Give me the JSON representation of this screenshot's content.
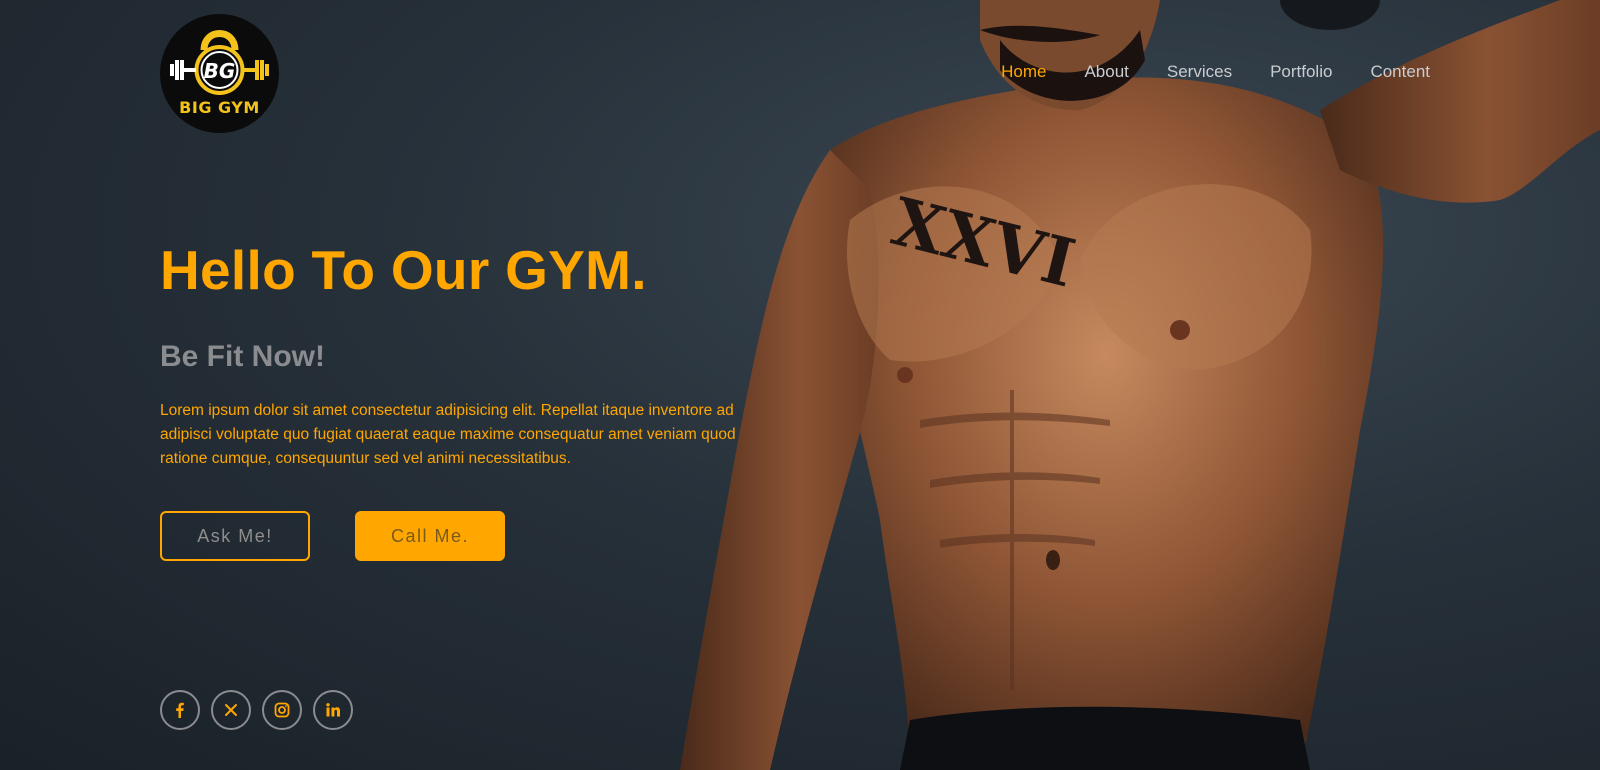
{
  "brand": {
    "logo_initials": "BG",
    "logo_text": "BIG GYM"
  },
  "nav": {
    "items": [
      {
        "label": "Home",
        "active": true
      },
      {
        "label": "About",
        "active": false
      },
      {
        "label": "Services",
        "active": false
      },
      {
        "label": "Portfolio",
        "active": false
      },
      {
        "label": "Content",
        "active": false
      }
    ]
  },
  "hero": {
    "title": "Hello To Our GYM.",
    "subtitle": "Be Fit Now!",
    "text": "Lorem ipsum dolor sit amet consectetur adipisicing elit. Repellat itaque inventore ad adipisci voluptate quo fugiat quaerat eaque maxime consequatur amet veniam quod ratione cumque, consequuntur sed vel animi necessitatibus.",
    "ask_label": "Ask Me!",
    "call_label": "Call Me."
  },
  "social": {
    "icons": [
      "facebook-icon",
      "x-icon",
      "instagram-icon",
      "linkedin-icon"
    ]
  },
  "colors": {
    "accent": "#ffa600",
    "background": "#222b33",
    "muted_text": "#8a8c8f"
  }
}
